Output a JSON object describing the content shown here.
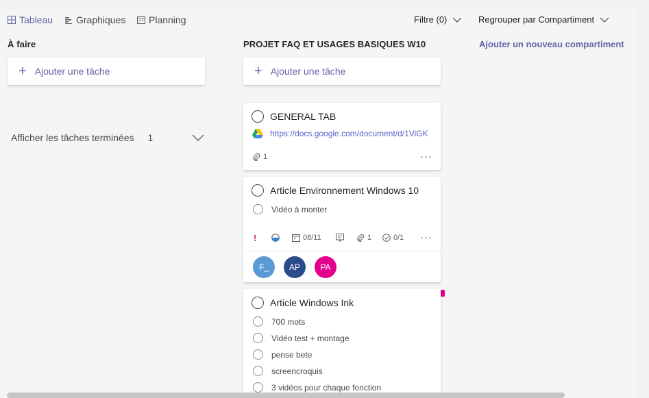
{
  "toolbar": {
    "tabs": [
      {
        "label": "Tableau",
        "icon": "board-grid-icon",
        "active": true
      },
      {
        "label": "Graphiques",
        "icon": "charts-icon",
        "active": false
      },
      {
        "label": "Planning",
        "icon": "calendar-icon",
        "active": false
      }
    ],
    "filter_label": "Filtre (0)",
    "group_label": "Regrouper par Compartiment"
  },
  "columns": [
    {
      "title": "À faire",
      "add_task": "Ajouter une tâche",
      "show_done_label": "Afficher les tâches terminées",
      "show_done_count": "1"
    },
    {
      "title": "PROJET FAQ ET USAGES BASIQUES W10",
      "add_task": "Ajouter une tâche",
      "cards": [
        {
          "title": "GENERAL TAB",
          "link_text": "https://docs.google.com/document/d/1ViGK",
          "link_icon": "google-drive-icon",
          "attachments": "1",
          "more": "···"
        },
        {
          "title": "Article Environnement Windows 10",
          "checklist": [
            "Vidéo à monter"
          ],
          "priority": "!",
          "progress": "half",
          "due_date": "08/11",
          "attachments": "1",
          "checklist_count": "0/1",
          "more": "···",
          "assignees": [
            {
              "initials": "F_",
              "color": "#5b9bd5"
            },
            {
              "initials": "AP",
              "color": "#2b4c8c"
            },
            {
              "initials": "PA",
              "color": "#e3008c"
            }
          ]
        },
        {
          "title": "Article Windows Ink",
          "checklist": [
            "700 mots",
            "Vidéo test + montage",
            "pense bete",
            "screencroquis",
            "3 vidéos pour chaque fonction"
          ]
        }
      ]
    }
  ],
  "add_bucket": "Ajouter un nouveau compartiment",
  "colors": {
    "accent": "#6264a7",
    "priority": "#c4314b",
    "magenta": "#e3008c"
  }
}
